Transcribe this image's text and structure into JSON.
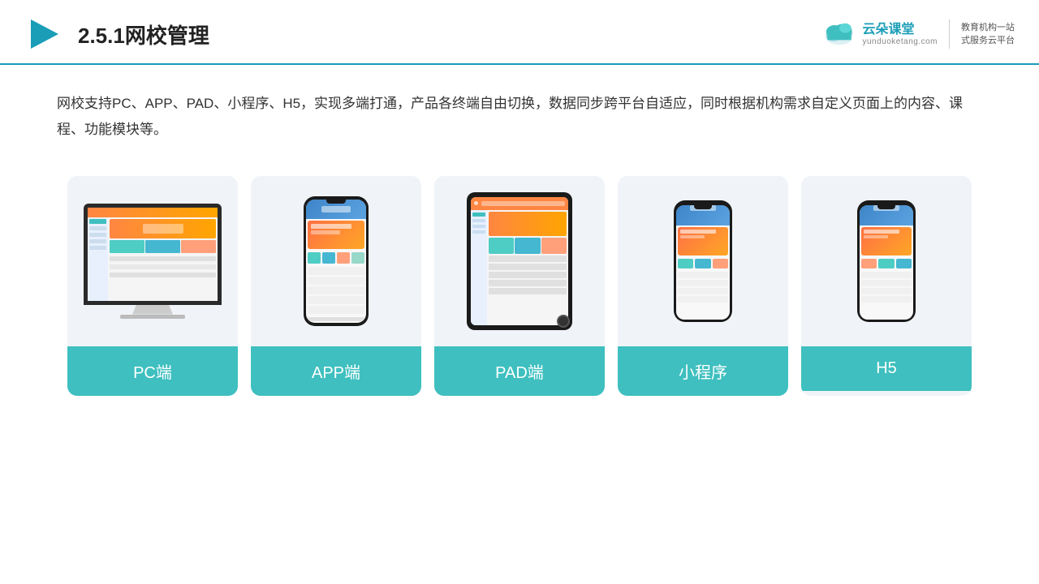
{
  "header": {
    "title": "2.5.1网校管理",
    "brand": {
      "name": "云朵课堂",
      "url": "yunduoketang.com",
      "slogan": "教育机构一站\n式服务云平台"
    }
  },
  "description": "网校支持PC、APP、PAD、小程序、H5，实现多端打通，产品各终端自由切换，数据同步跨平台自适应，同时根据机构需求自定义页面上的内容、课程、功能模块等。",
  "cards": [
    {
      "id": "pc",
      "label": "PC端"
    },
    {
      "id": "app",
      "label": "APP端"
    },
    {
      "id": "pad",
      "label": "PAD端"
    },
    {
      "id": "miniprogram",
      "label": "小程序"
    },
    {
      "id": "h5",
      "label": "H5"
    }
  ],
  "colors": {
    "accent": "#1a9db7",
    "card_bg": "#f0f4f8",
    "card_label_bg": "#3fbfbf",
    "header_line": "#1a9db7"
  }
}
